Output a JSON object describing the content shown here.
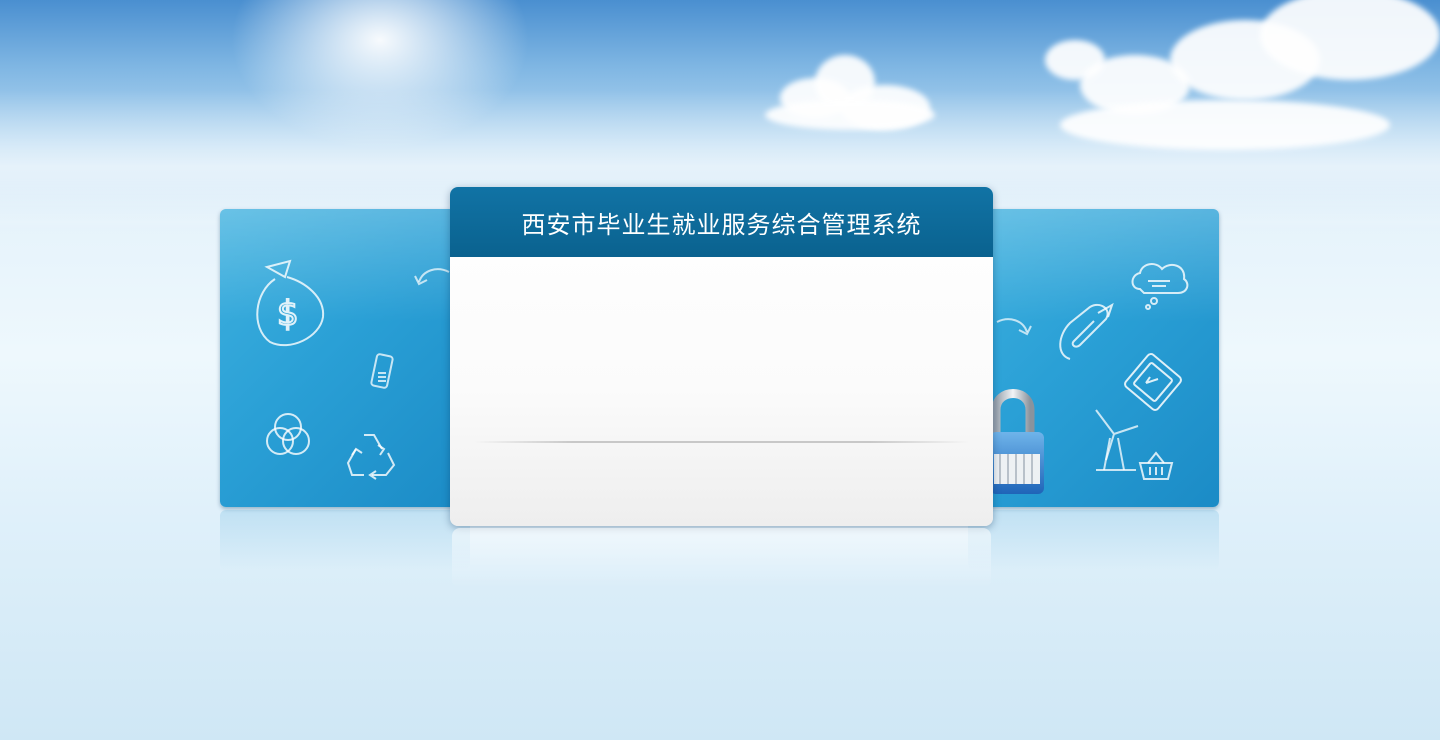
{
  "page": {
    "title": "西安市毕业生就业服务综合管理系统"
  },
  "icons": {
    "left_panel": [
      "money-bag-icon",
      "arrow-icon",
      "mobile-phone-icon",
      "three-circles-icon",
      "recycle-icon"
    ],
    "right_panel": [
      "cloud-chat-icon",
      "arrow-icon",
      "paperclip-icon",
      "tablet-icon",
      "windmill-icon",
      "shopping-basket-icon"
    ],
    "security": "padlock-icon"
  },
  "colors": {
    "header_blue": "#0a628f",
    "panel_blue": "#2aa0d6",
    "sky_top": "#4a8fd0"
  }
}
